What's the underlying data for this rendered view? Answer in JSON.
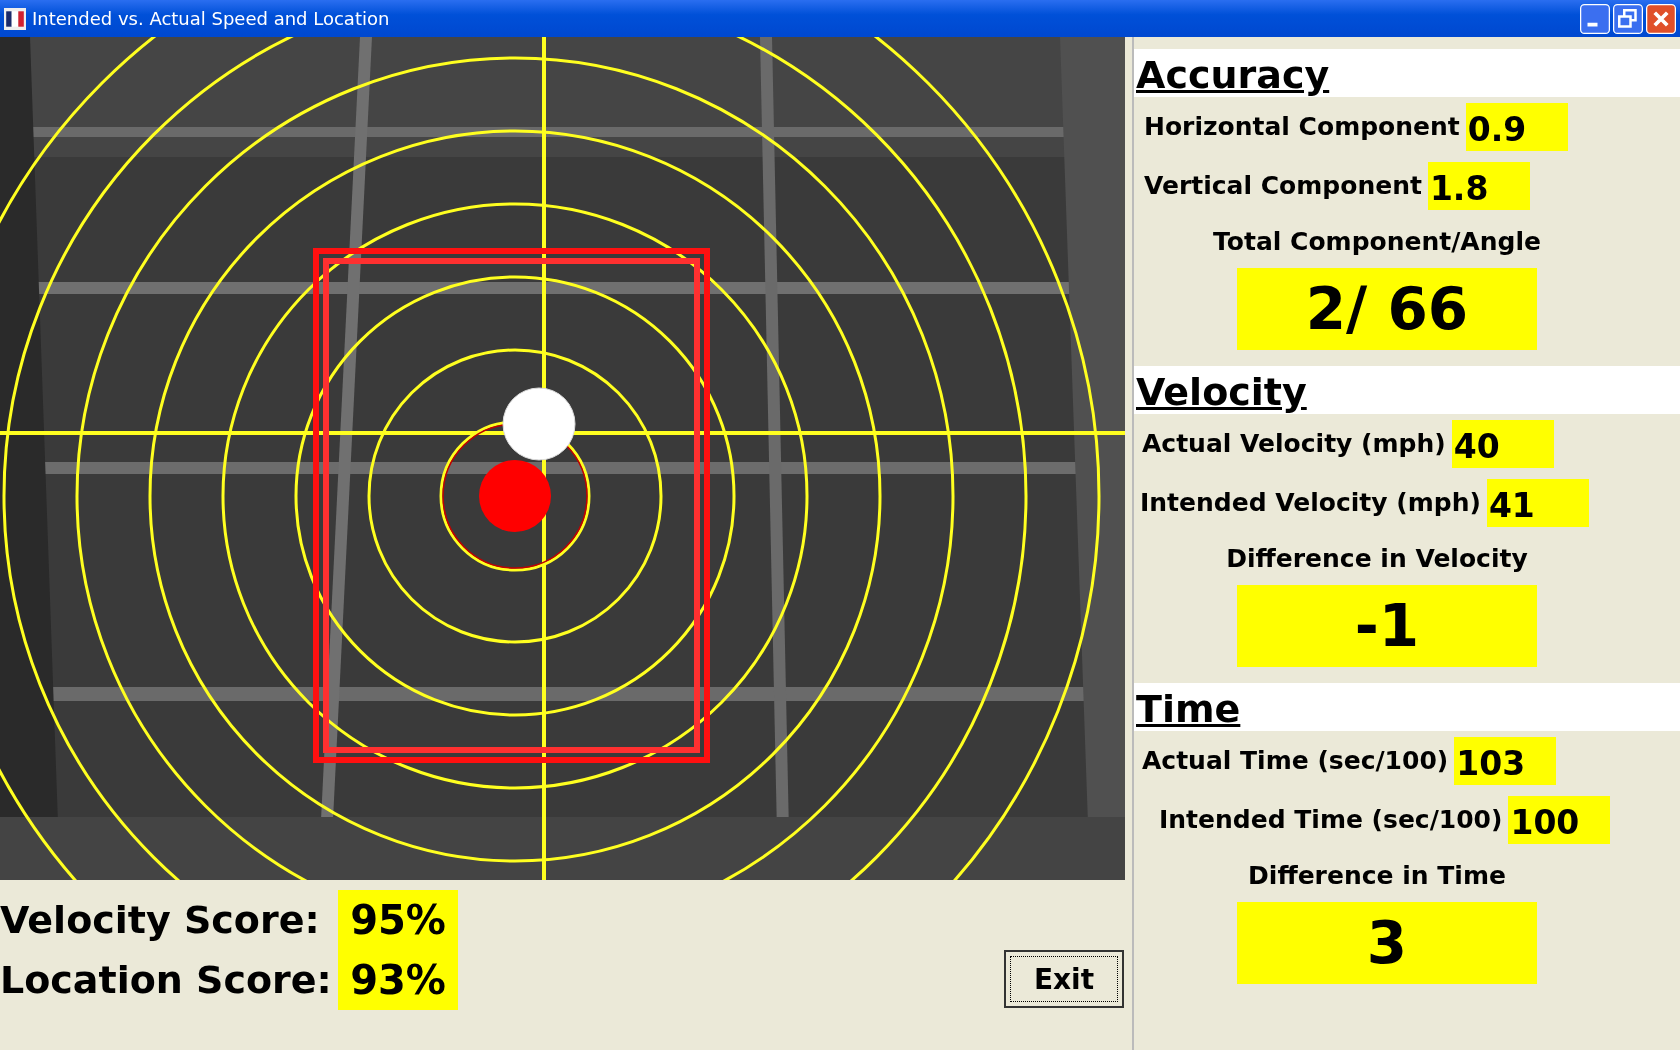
{
  "window": {
    "title": "Intended vs. Actual Speed and Location"
  },
  "scores": [
    {
      "label": "Velocity Score:",
      "value": "95%"
    },
    {
      "label": "Location Score:",
      "value": "93%"
    }
  ],
  "exit_button": "Exit",
  "sections": [
    {
      "title": "Accuracy",
      "rows": [
        {
          "label": "Horizontal Component",
          "value": "0.9"
        },
        {
          "label": "Vertical Component",
          "value": "1.8"
        }
      ],
      "total": {
        "label": "Total Component/Angle",
        "value": "2/ 66"
      }
    },
    {
      "title": "Velocity",
      "rows": [
        {
          "label": "Actual Velocity (mph)",
          "value": "40"
        },
        {
          "label": "Intended Velocity (mph)",
          "value": "41"
        }
      ],
      "total": {
        "label": "Difference in Velocity",
        "value": "-1"
      }
    },
    {
      "title": "Time",
      "rows": [
        {
          "label": "Actual Time (sec/100)",
          "value": "103"
        },
        {
          "label": "Intended Time (sec/100)",
          "value": "100"
        }
      ],
      "total": {
        "label": "Difference in Time",
        "value": "3"
      }
    }
  ]
}
